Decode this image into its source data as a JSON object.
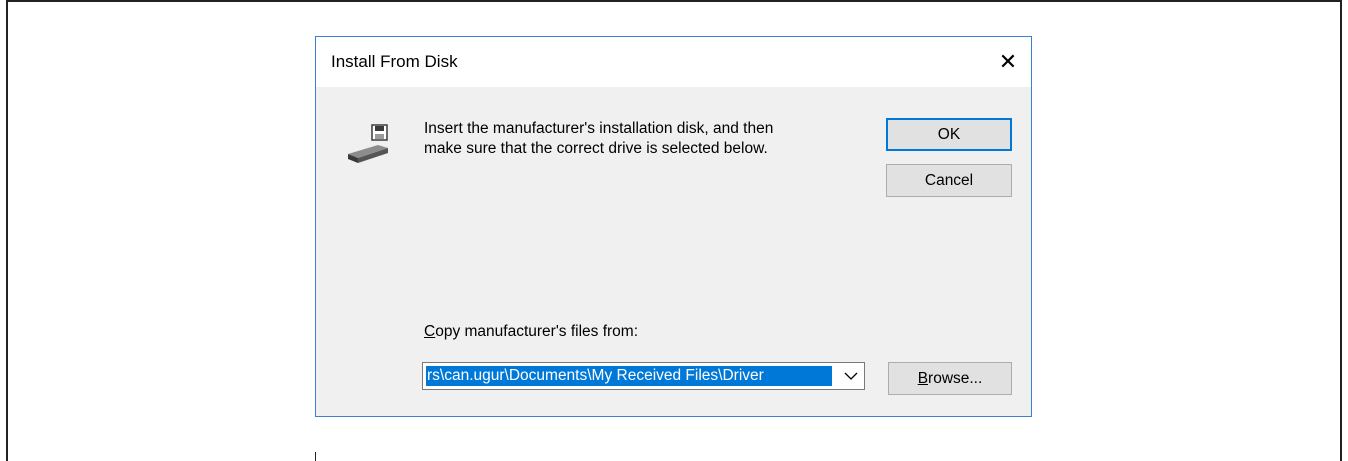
{
  "dialog": {
    "title": "Install From Disk",
    "close_glyph": "✕",
    "message_line1": "Insert the manufacturer's installation disk, and then",
    "message_line2": "make sure that the correct drive is selected below.",
    "ok_label": "OK",
    "cancel_label": "Cancel",
    "copy_label_accel": "C",
    "copy_label_rest": "opy manufacturer's files from:",
    "path_value": "rs\\can.ugur\\Documents\\My Received Files\\Driver",
    "browse_label_accel": "B",
    "browse_label_rest": "rowse...",
    "icons": {
      "disk": "floppy-disk-drive-icon",
      "dropdown": "chevron-down-icon",
      "close": "close-icon"
    },
    "colors": {
      "accent": "#0078d7",
      "dialog_border": "#3c7fd1",
      "dialog_bg": "#f0f0f0"
    }
  }
}
